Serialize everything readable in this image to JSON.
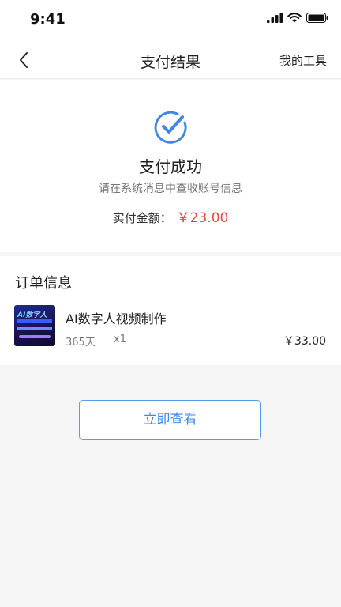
{
  "status_bar": {
    "time": "9:41"
  },
  "nav": {
    "title": "支付结果",
    "action_label": "我的工具"
  },
  "result": {
    "title": "支付成功",
    "subtitle": "请在系统消息中查收账号信息",
    "amount_label": "实付金额：",
    "amount_value": "￥23.00"
  },
  "order": {
    "heading": "订单信息",
    "item": {
      "name": "AI数字人视频制作",
      "duration": "365天",
      "quantity": "x1",
      "price": "￥33.00",
      "thumb_text": "AI数字人"
    }
  },
  "actions": {
    "view_label": "立即查看"
  },
  "colors": {
    "accent_blue": "#3f86e6",
    "amount_red": "#e5473d"
  }
}
